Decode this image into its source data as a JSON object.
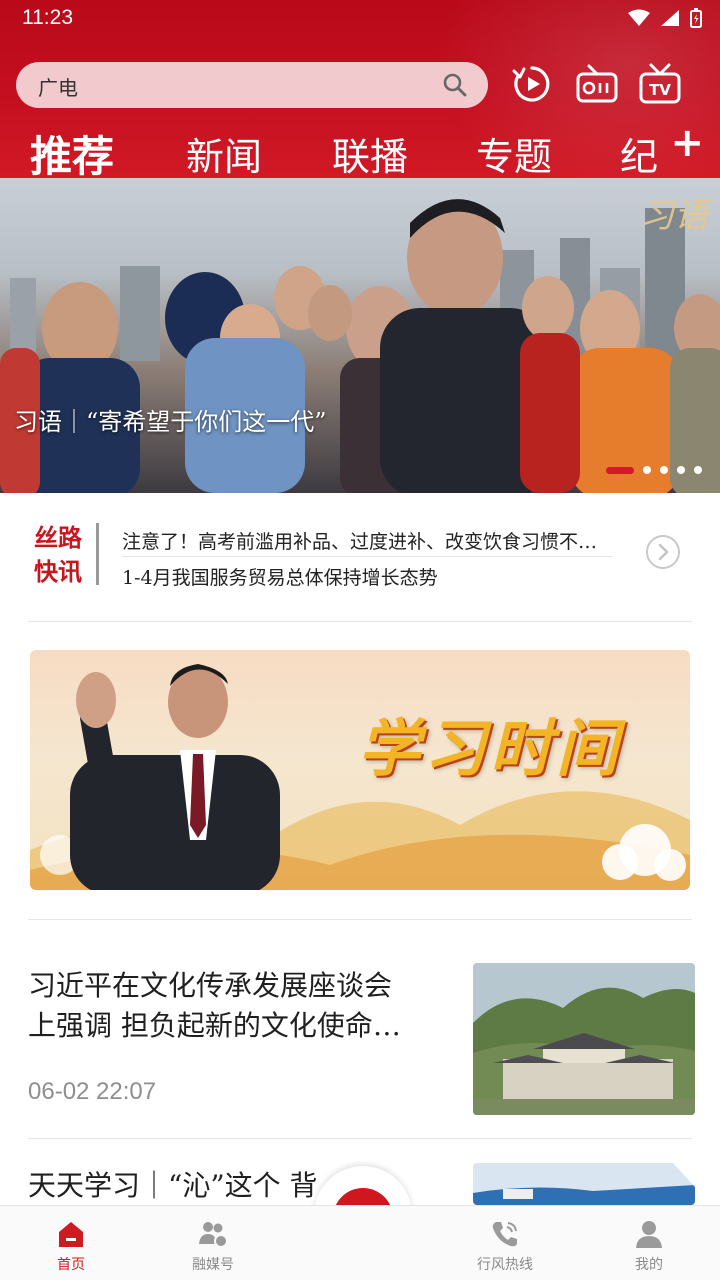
{
  "status_bar": {
    "time": "11:23"
  },
  "search": {
    "text": "广电"
  },
  "tabs": [
    {
      "label": "推荐",
      "active": true
    },
    {
      "label": "新闻",
      "active": false
    },
    {
      "label": "联播",
      "active": false
    },
    {
      "label": "专题",
      "active": false
    },
    {
      "label": "纪",
      "active": false
    }
  ],
  "tabs_more_label": "+",
  "banner": {
    "caption": "习语｜“寄希望于你们这一代”",
    "logo_text": "习语",
    "slide_count": 5,
    "active_slide": 1
  },
  "flash_news": {
    "title_line1": "丝路",
    "title_line2": "快讯",
    "items": [
      "注意了！高考前滥用补品、过度进补、改变饮食习惯不…",
      "1-4月我国服务贸易总体保持增长态势"
    ]
  },
  "study_banner": {
    "title": "学习时间"
  },
  "news": [
    {
      "title_line1": "习近平在文化传承发展座谈会",
      "title_line2": "上强调  担负起新的文化使命…",
      "time": "06-02  22:07"
    },
    {
      "title_line1": "天天学习｜“沁”这个  背"
    }
  ],
  "bottom_nav": [
    {
      "label": "首页",
      "active": true
    },
    {
      "label": "融媒号",
      "active": false
    },
    {
      "label": "",
      "active": false
    },
    {
      "label": "行风热线",
      "active": false
    },
    {
      "label": "我的",
      "active": false
    }
  ],
  "colors": {
    "brand_red": "#c8161f",
    "nav_active": "#d01a22"
  }
}
